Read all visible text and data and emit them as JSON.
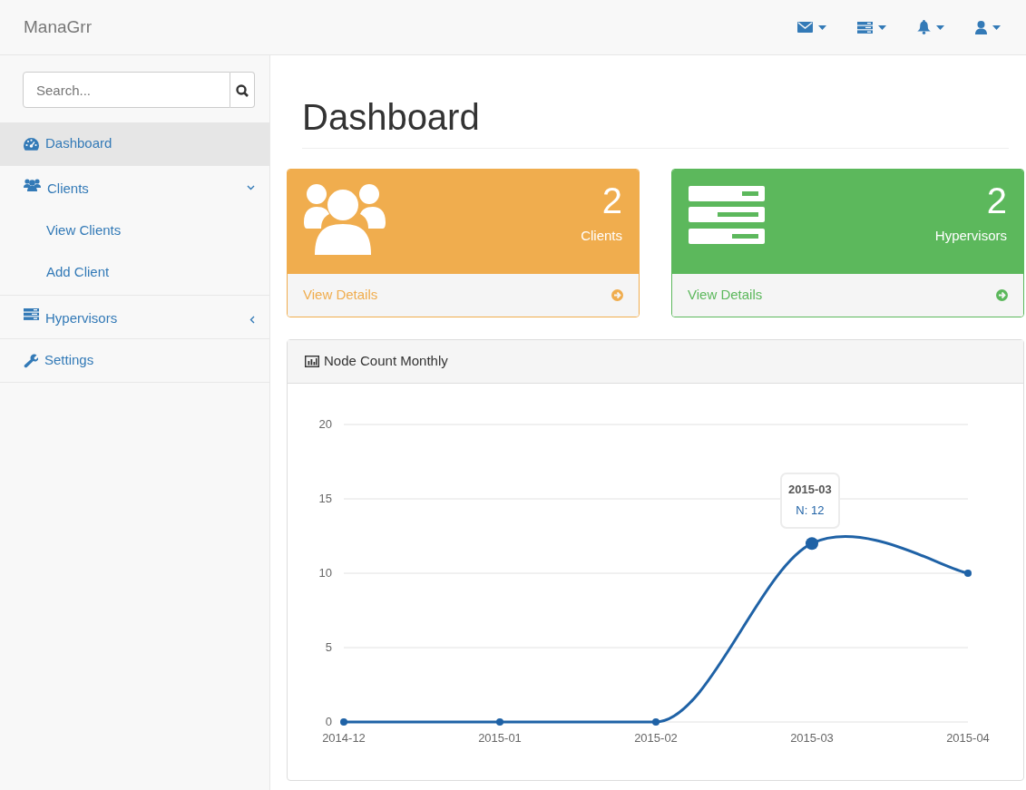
{
  "navbar": {
    "brand": "ManaGrr"
  },
  "sidebar": {
    "search": {
      "placeholder": "Search..."
    },
    "items": [
      {
        "label": "Dashboard",
        "selected": true
      },
      {
        "label": "Clients",
        "selected": false,
        "expanded": true,
        "children": [
          {
            "label": "View Clients"
          },
          {
            "label": "Add Client"
          }
        ]
      },
      {
        "label": "Hypervisors",
        "selected": false,
        "expanded": false
      },
      {
        "label": "Settings",
        "selected": false
      }
    ]
  },
  "page": {
    "title": "Dashboard"
  },
  "stats": [
    {
      "count": "2",
      "label": "Clients",
      "link": "View Details",
      "color": "#f0ad4e"
    },
    {
      "count": "2",
      "label": "Hypervisors",
      "link": "View Details",
      "color": "#5cb85c"
    }
  ],
  "panel": {
    "title": "Node Count Monthly",
    "tooltip": {
      "title": "2015-03",
      "text": "N: 12"
    },
    "chart_data": {
      "type": "line",
      "categories": [
        "2014-12",
        "2015-01",
        "2015-02",
        "2015-03",
        "2015-04"
      ],
      "series": [
        {
          "color": "#1f62a6",
          "values": [
            0,
            0,
            0,
            12,
            10
          ],
          "marker": true
        }
      ],
      "grid": true,
      "ylim": [
        0,
        20
      ],
      "yticks": [
        0,
        5,
        10,
        15,
        20
      ]
    }
  }
}
